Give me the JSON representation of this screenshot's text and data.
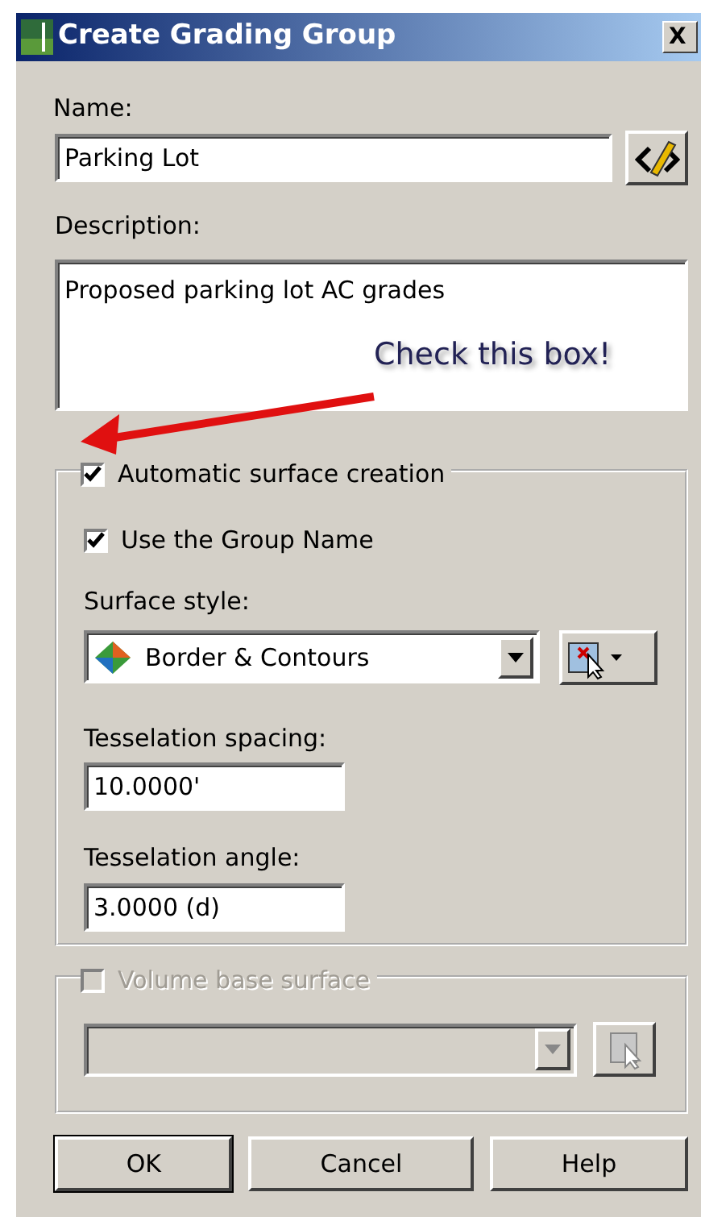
{
  "window": {
    "title": "Create Grading Group",
    "close": "X"
  },
  "name_field": {
    "label": "Name:",
    "value": "Parking Lot"
  },
  "description": {
    "label": "Description:",
    "value": "Proposed parking lot AC grades"
  },
  "annotation": {
    "text": "Check this box!"
  },
  "auto_surface": {
    "label": "Automatic surface creation",
    "checked": true,
    "use_group_name": {
      "label": "Use the Group Name",
      "checked": true
    },
    "surface_style": {
      "label": "Surface style:",
      "value": "Border & Contours"
    },
    "tesselation_spacing": {
      "label": "Tesselation spacing:",
      "value": "10.0000'"
    },
    "tesselation_angle": {
      "label": "Tesselation angle:",
      "value": "3.0000 (d)"
    }
  },
  "volume_base": {
    "label": "Volume base surface",
    "checked": false,
    "disabled": true
  },
  "buttons": [
    {
      "label": "OK",
      "default": true
    },
    {
      "label": "Cancel",
      "default": false
    },
    {
      "label": "Help",
      "default": false
    }
  ]
}
